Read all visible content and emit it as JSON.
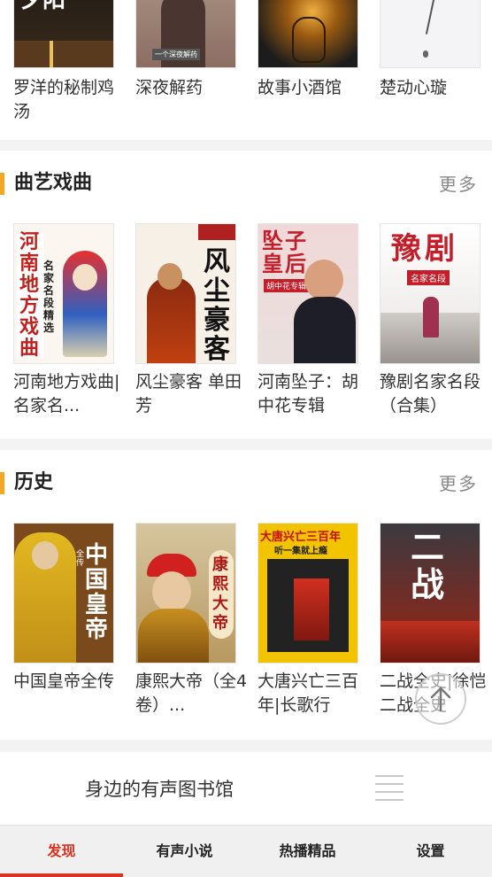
{
  "top_books": [
    {
      "title": "罗洋的秘制鸡汤",
      "cover_text": "夕阳"
    },
    {
      "title": "深夜解药",
      "cover_text": "一个深夜解药"
    },
    {
      "title": "故事小酒馆",
      "cover_text": ""
    },
    {
      "title": "楚动心璇",
      "cover_text": ""
    }
  ],
  "sections": [
    {
      "title": "曲艺戏曲",
      "more": "更多",
      "books": [
        {
          "title": "河南地方戏曲|名家名...",
          "cover_text": "河南地方戏曲",
          "cover_sub": "名家名段精选"
        },
        {
          "title": "风尘豪客 单田芳",
          "cover_text": "风尘豪客",
          "cover_sub": ""
        },
        {
          "title": "河南坠子：胡中花专辑",
          "cover_text": "坠子皇后",
          "cover_sub": "胡中花专辑"
        },
        {
          "title": "豫剧名家名段（合集）",
          "cover_text": "豫剧",
          "cover_sub": "名家名段"
        }
      ]
    },
    {
      "title": "历史",
      "more": "更多",
      "books": [
        {
          "title": "中国皇帝全传",
          "cover_text": "中国皇帝",
          "cover_sub": "全传"
        },
        {
          "title": "康熙大帝（全4卷）...",
          "cover_text": "康熙大帝",
          "cover_sub": ""
        },
        {
          "title": "大唐兴亡三百年|长歌行",
          "cover_text": "大唐兴亡三百年",
          "cover_sub": "听一集就上瘾"
        },
        {
          "title": "二战全史|徐恺二战全史",
          "cover_text": "二战",
          "cover_sub": ""
        }
      ]
    }
  ],
  "library_bar": {
    "title": "身边的有声图书馆"
  },
  "tabs": [
    {
      "label": "发现"
    },
    {
      "label": "有声小说"
    },
    {
      "label": "热播精品"
    },
    {
      "label": "设置"
    }
  ],
  "colors": {
    "accent": "#d9321e",
    "section_bar": "#f5a623"
  }
}
